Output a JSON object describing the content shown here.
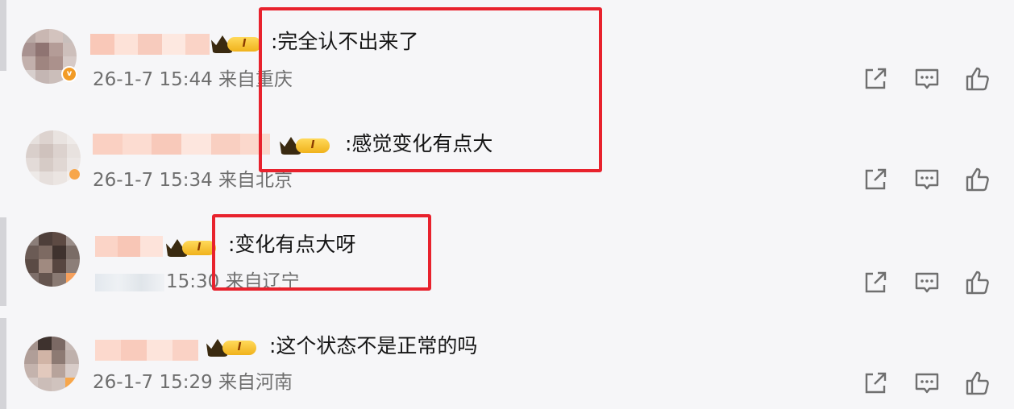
{
  "vip_level": "I",
  "comments": [
    {
      "text": ":完全认不出来了",
      "time": "26-1-7 15:44",
      "location": "来自重庆"
    },
    {
      "text": ":感觉变化有点大",
      "time": "26-1-7 15:34",
      "location": "来自北京"
    },
    {
      "text": ":变化有点大呀",
      "time": "15:30",
      "location": "来自辽宁"
    },
    {
      "text": ":这个状态不是正常的吗",
      "time": "26-1-7 15:29",
      "location": "来自河南"
    }
  ],
  "actions": [
    "share-icon",
    "comment-icon",
    "like-icon"
  ],
  "colors": {
    "highlight": "#e8222d",
    "background": "#f6f6f8",
    "vip_badge": "#f0b21c"
  }
}
